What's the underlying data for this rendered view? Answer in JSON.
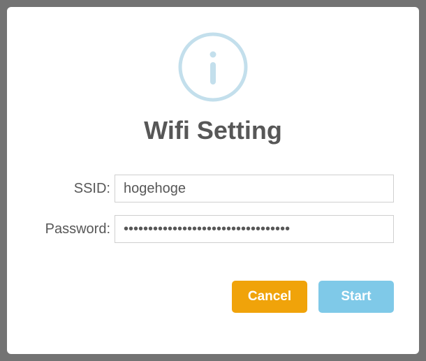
{
  "modal": {
    "title": "Wifi Setting",
    "icon": "info-icon",
    "fields": {
      "ssid": {
        "label": "SSID:",
        "value": "hogehoge"
      },
      "password": {
        "label": "Password:",
        "value": "••••••••••••••••••••••••••••••••••"
      }
    },
    "buttons": {
      "cancel": "Cancel",
      "start": "Start"
    },
    "colors": {
      "cancel": "#f0a30a",
      "start": "#7fc9e8",
      "icon_stroke": "#c3dfec"
    }
  }
}
